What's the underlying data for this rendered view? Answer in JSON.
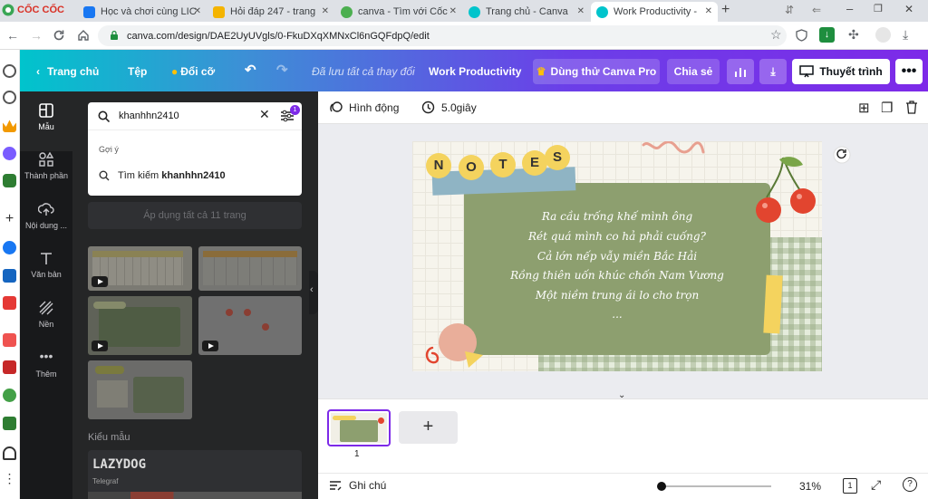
{
  "browser": {
    "tabs": [
      {
        "label": "Học và chơi cùng LIC",
        "icon_color": "#1877f2"
      },
      {
        "label": "Hỏi đáp 247 - trang",
        "icon_color": "#f4b400"
      },
      {
        "label": "canva - Tìm với Cốc",
        "icon_color": "#4caf50"
      },
      {
        "label": "Trang chủ - Canva",
        "icon_color": "#00c4cc"
      },
      {
        "label": "Work Productivity -",
        "icon_color": "#00c4cc"
      }
    ],
    "logo": "CỐC CỐC",
    "url": "canva.com/design/DAE2UyUVgls/0-FkuDXqXMNxCl6nGQFdpQ/edit"
  },
  "header": {
    "home": "Trang chủ",
    "file": "Tệp",
    "resize": "Đổi cỡ",
    "saved": "Đã lưu tất cả thay đổi",
    "title": "Work Productivity",
    "pro": "Dùng thử Canva Pro",
    "share": "Chia sẻ",
    "present": "Thuyết trình"
  },
  "rail": [
    {
      "label": "Mẫu",
      "icon": "template-icon"
    },
    {
      "label": "Thành phần",
      "icon": "elements-icon"
    },
    {
      "label": "Nội dung ...",
      "icon": "upload-icon"
    },
    {
      "label": "Văn bản",
      "icon": "text-icon"
    },
    {
      "label": "Nền",
      "icon": "background-icon"
    },
    {
      "label": "Thêm",
      "icon": "more-icon"
    }
  ],
  "panel": {
    "search_value": "khanhhn2410",
    "filter_badge": "1",
    "suggest_heading": "Gợi ý",
    "suggest_prefix": "Tìm kiếm",
    "suggest_term": "khanhhn2410",
    "apply_all": "Áp dụng tất cả 11 trang",
    "styles_heading": "Kiểu mẫu",
    "font_sample": "LAZYDOG",
    "font_name": "Telegraf"
  },
  "editor": {
    "animate": "Hình động",
    "duration": "5.0giây",
    "page_number": "1",
    "notes": "Ghi chú",
    "zoom": "31%",
    "page_count": "1"
  },
  "design": {
    "title_letters": [
      "N",
      "O",
      "T",
      "E",
      "S"
    ],
    "poem_lines": [
      "Ra cầu trống khế mình ông",
      "Rét quá mình co hả phải cuống?",
      "Cả lớn nếp vẫy miền Bắc Hải",
      "Rồng thiên uốn khúc chốn Nam Vương",
      "Một niềm trung ái lo cho trọn",
      "..."
    ]
  }
}
